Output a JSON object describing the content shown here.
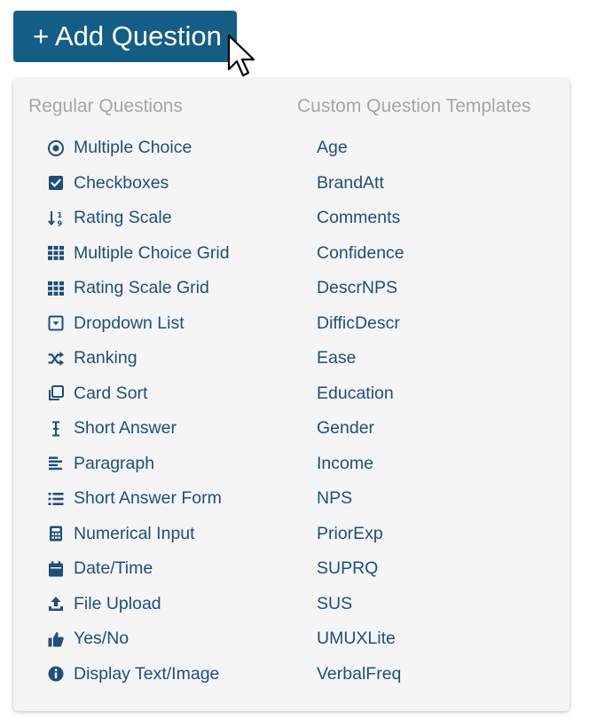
{
  "add_button": {
    "label": "+ Add Question",
    "color": "#145e85"
  },
  "menu": {
    "regular_heading": "Regular Questions",
    "custom_heading": "Custom Question Templates",
    "item_color": "#1f4e79",
    "regular": [
      {
        "label": "Multiple Choice",
        "icon": "radio-button-icon"
      },
      {
        "label": "Checkboxes",
        "icon": "checkbox-icon"
      },
      {
        "label": "Rating Scale",
        "icon": "sort-numeric-icon"
      },
      {
        "label": "Multiple Choice Grid",
        "icon": "grid-icon"
      },
      {
        "label": "Rating Scale Grid",
        "icon": "grid-icon"
      },
      {
        "label": "Dropdown List",
        "icon": "dropdown-icon"
      },
      {
        "label": "Ranking",
        "icon": "shuffle-icon"
      },
      {
        "label": "Card Sort",
        "icon": "cards-icon"
      },
      {
        "label": "Short Answer",
        "icon": "text-cursor-icon"
      },
      {
        "label": "Paragraph",
        "icon": "paragraph-icon"
      },
      {
        "label": "Short Answer Form",
        "icon": "list-icon"
      },
      {
        "label": "Numerical Input",
        "icon": "calculator-icon"
      },
      {
        "label": "Date/Time",
        "icon": "calendar-icon"
      },
      {
        "label": "File Upload",
        "icon": "upload-icon"
      },
      {
        "label": "Yes/No",
        "icon": "thumbs-up-icon"
      },
      {
        "label": "Display Text/Image",
        "icon": "info-icon"
      }
    ],
    "custom": [
      "Age",
      "BrandAtt",
      "Comments",
      "Confidence",
      "DescrNPS",
      "DifficDescr",
      "Ease",
      "Education",
      "Gender",
      "Income",
      "NPS",
      "PriorExp",
      "SUPRQ",
      "SUS",
      "UMUXLite",
      "VerbalFreq"
    ]
  }
}
